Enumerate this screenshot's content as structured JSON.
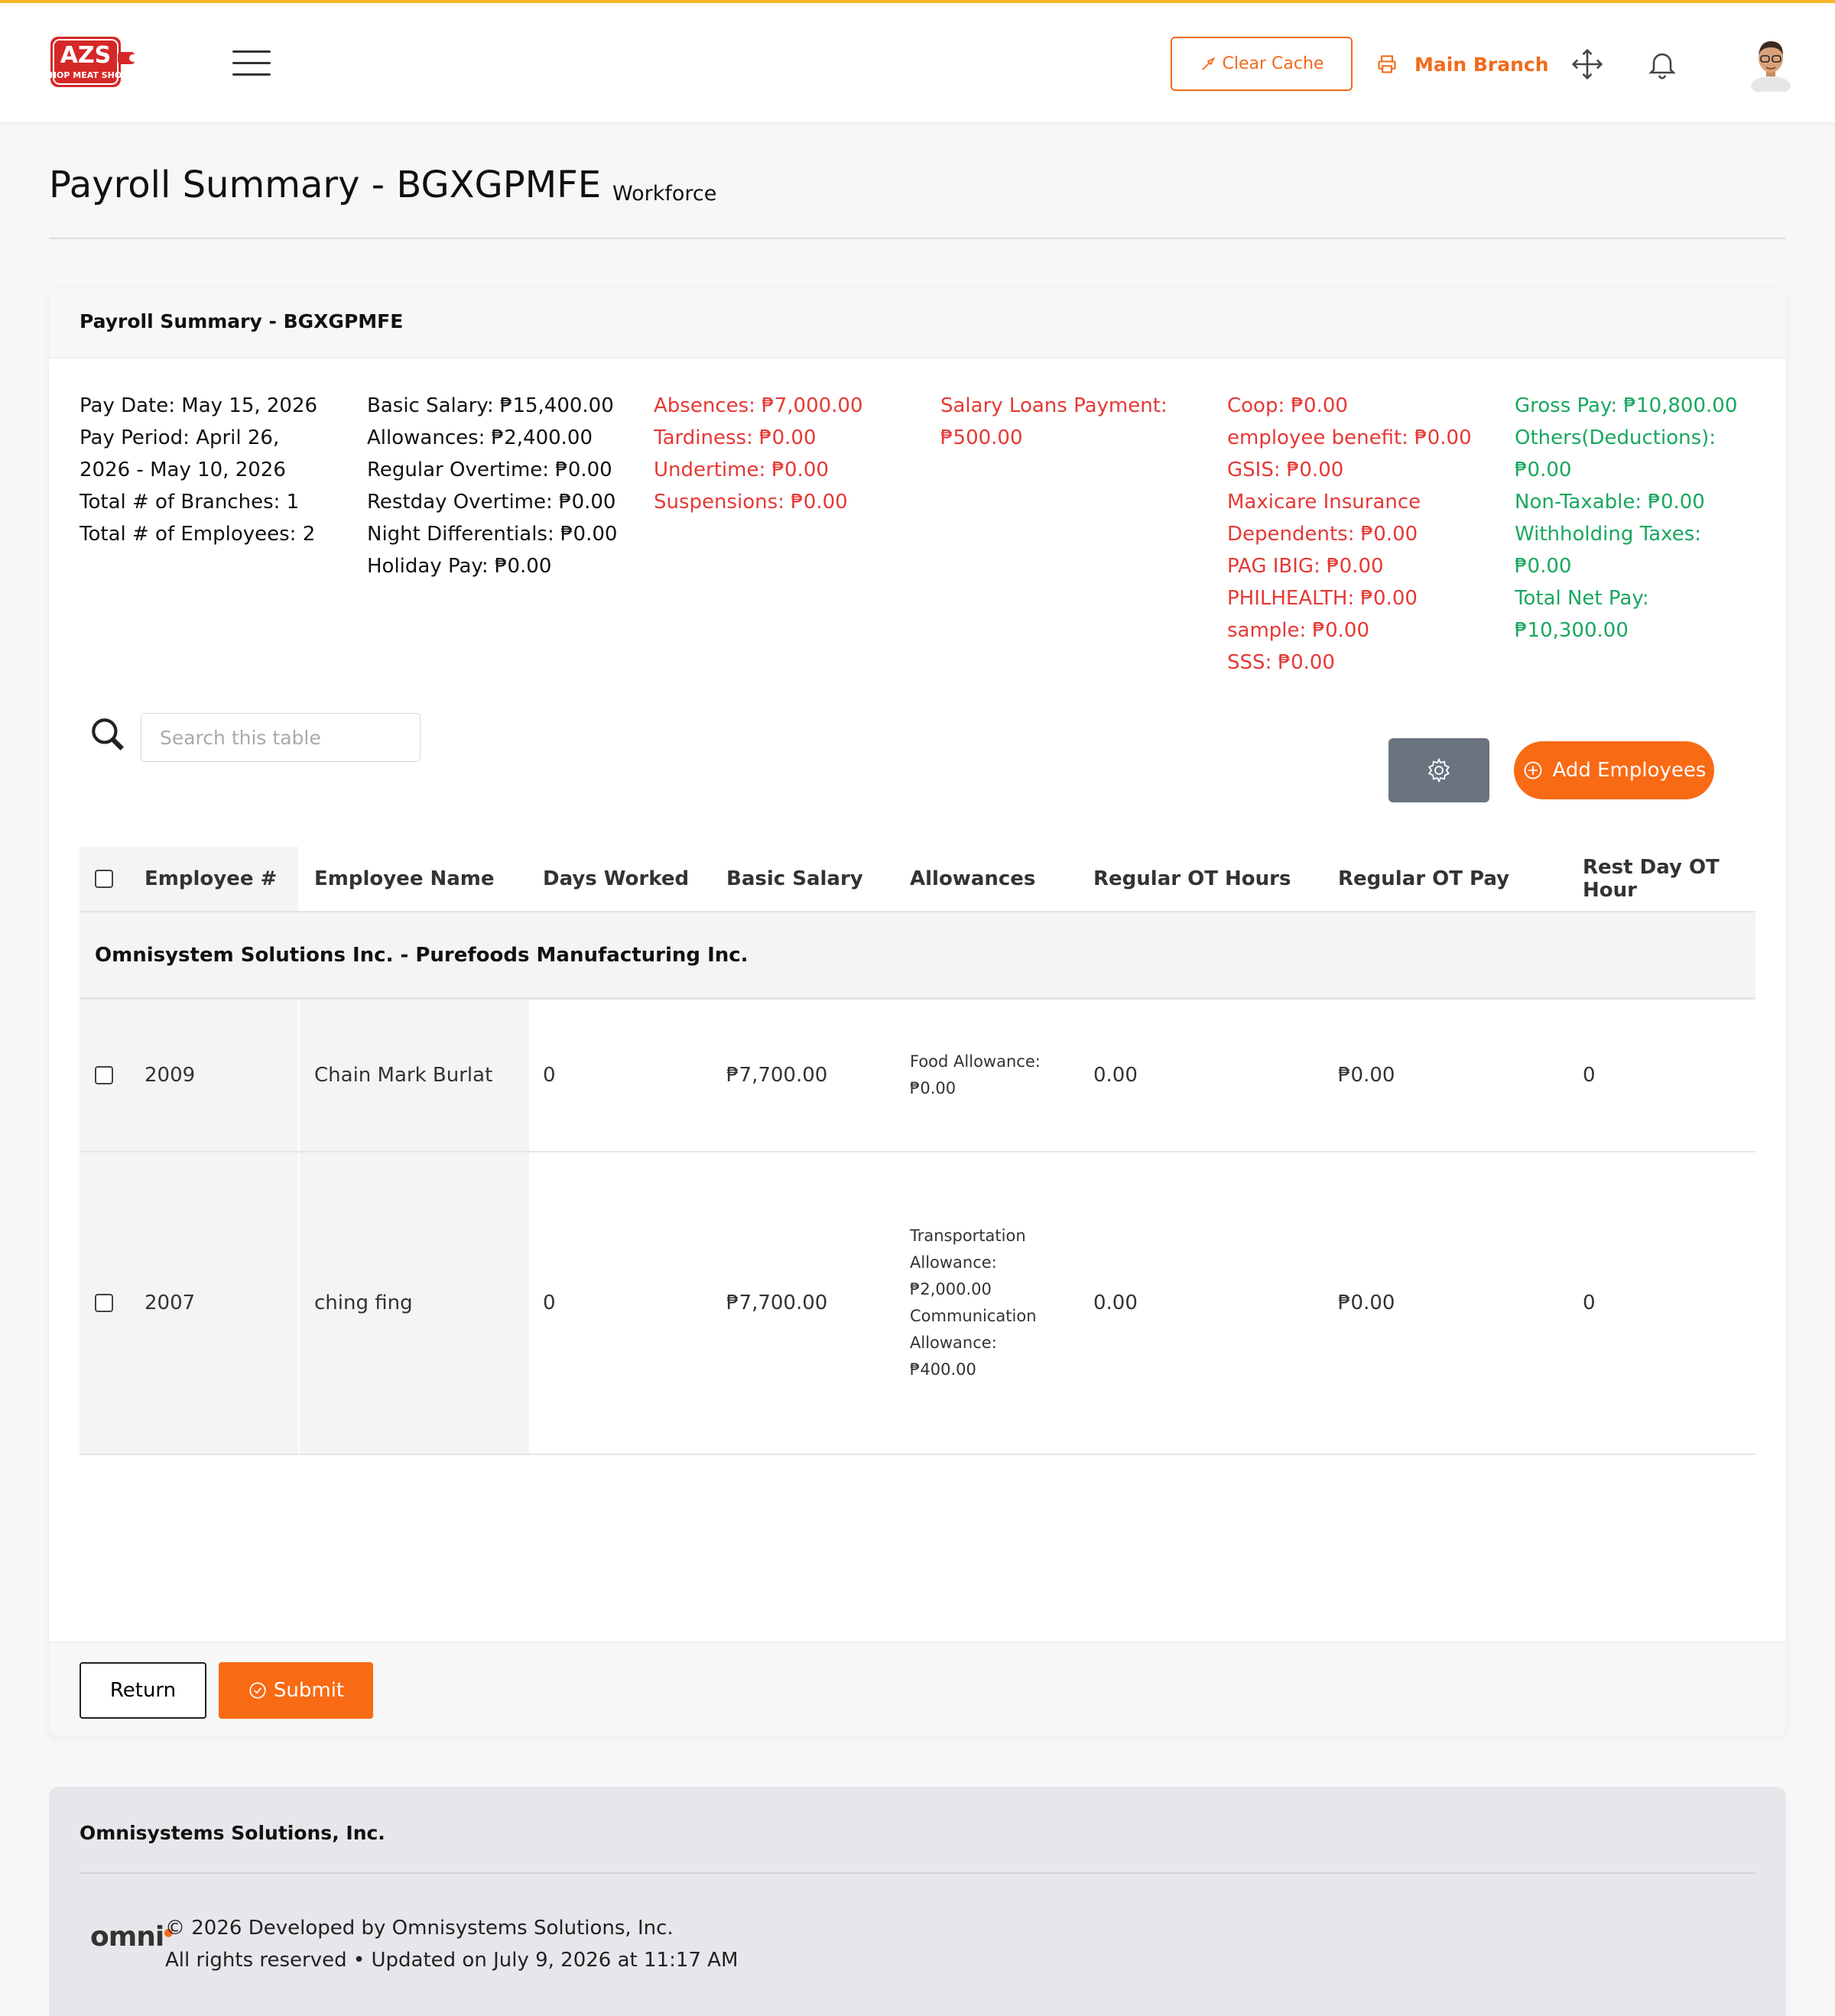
{
  "header": {
    "logo_text": "AZS",
    "logo_sub": "CHOP MEAT SHOP",
    "clear_cache": "Clear Cache",
    "branch": "Main Branch"
  },
  "page": {
    "title": "Payroll Summary - BGXGPMFE",
    "subtitle": "Workforce"
  },
  "card": {
    "title": "Payroll Summary - BGXGPMFE",
    "summary": {
      "col1": [
        "Pay Date: May 15, 2026",
        "Pay Period: April 26,",
        "2026 - May 10, 2026",
        "Total # of Branches: 1",
        "Total # of Employees: 2"
      ],
      "col2": [
        "Basic Salary: ₱15,400.00",
        "Allowances: ₱2,400.00",
        "Regular Overtime: ₱0.00",
        "Restday Overtime: ₱0.00",
        "Night Differentials: ₱0.00",
        "Holiday Pay: ₱0.00"
      ],
      "col3": [
        "Absences: ₱7,000.00",
        "Tardiness: ₱0.00",
        "Undertime: ₱0.00",
        "Suspensions: ₱0.00"
      ],
      "col4": [
        "Salary Loans Payment:",
        "₱500.00"
      ],
      "col5": [
        "Coop: ₱0.00",
        "employee benefit: ₱0.00",
        "GSIS: ₱0.00",
        "Maxicare Insurance",
        "Dependents: ₱0.00",
        "PAG IBIG: ₱0.00",
        "PHILHEALTH: ₱0.00",
        "sample: ₱0.00",
        "SSS: ₱0.00"
      ],
      "col6": [
        "Gross Pay: ₱10,800.00",
        "Others(Deductions):",
        "₱0.00",
        "Non-Taxable: ₱0.00",
        "Withholding Taxes:",
        "₱0.00",
        "Total Net Pay:",
        "₱10,300.00"
      ]
    },
    "search_placeholder": "Search this table",
    "add_employees": "Add Employees",
    "return_label": "Return",
    "submit_label": "Submit"
  },
  "table": {
    "columns": [
      "Employee #",
      "Employee Name",
      "Days Worked",
      "Basic Salary",
      "Allowances",
      "Regular OT Hours",
      "Regular OT Pay",
      "Rest Day OT Hour"
    ],
    "group": "Omnisystem Solutions Inc. - Purefoods Manufacturing Inc.",
    "rows": [
      {
        "emp_no": "2009",
        "name": "Chain Mark Burlat",
        "days": "0",
        "basic": "₱7,700.00",
        "allowances": [
          "Food Allowance:",
          "₱0.00"
        ],
        "ot_hours": "0.00",
        "ot_pay": "₱0.00",
        "rest_ot": "0"
      },
      {
        "emp_no": "2007",
        "name": "ching fing",
        "days": "0",
        "basic": "₱7,700.00",
        "allowances": [
          "Transportation",
          "Allowance:",
          "₱2,000.00",
          "Communication",
          "Allowance:",
          "₱400.00"
        ],
        "ot_hours": "0.00",
        "ot_pay": "₱0.00",
        "rest_ot": "0"
      }
    ]
  },
  "footer": {
    "company": "Omnisystems Solutions, Inc.",
    "logo": "omni",
    "line1": "© 2026 Developed by Omnisystems Solutions, Inc.",
    "line2": "All rights reserved • Updated on July 9, 2026 at 11:17 AM"
  },
  "colors": {
    "accent": "#f96a14",
    "deduction": "#e53935",
    "positive": "#1aa760",
    "top_border": "#f5b425"
  }
}
